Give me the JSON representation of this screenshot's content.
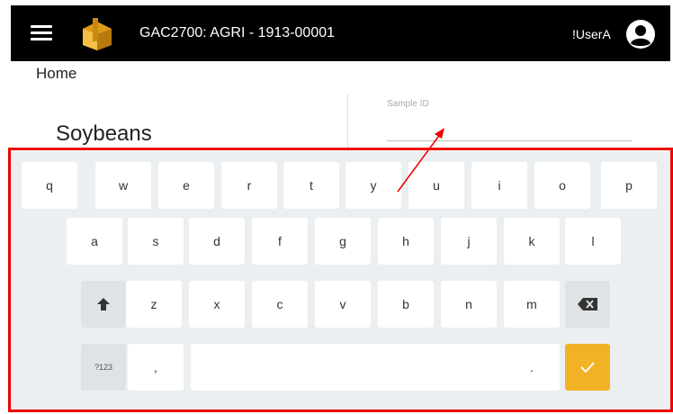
{
  "header": {
    "app_title": "GAC2700: AGRI - 1913-00001",
    "user_name": "!UserA",
    "icons": [
      "menu-icon",
      "logo-icon",
      "user-account-icon"
    ]
  },
  "breadcrumb": "Home",
  "crop": {
    "name": "Soybeans"
  },
  "sample_id": {
    "label": "Sample ID",
    "value": ""
  },
  "keyboard": {
    "row1": [
      "q",
      "w",
      "e",
      "r",
      "t",
      "y",
      "u",
      "i",
      "o",
      "p"
    ],
    "row2": [
      "a",
      "s",
      "d",
      "f",
      "g",
      "h",
      "j",
      "k",
      "l"
    ],
    "row3": [
      "z",
      "x",
      "c",
      "v",
      "b",
      "n",
      "m"
    ],
    "symbols_label": "?123",
    "comma_label": ",",
    "period_label": ".",
    "shift_icon": "shift-arrow-icon",
    "backspace_icon": "backspace-icon",
    "enter_icon": "checkmark-icon",
    "accent_color": "#f2b225"
  },
  "annotations": {
    "highlight_color": "#ee0000",
    "arrow_color": "#ee0000"
  }
}
